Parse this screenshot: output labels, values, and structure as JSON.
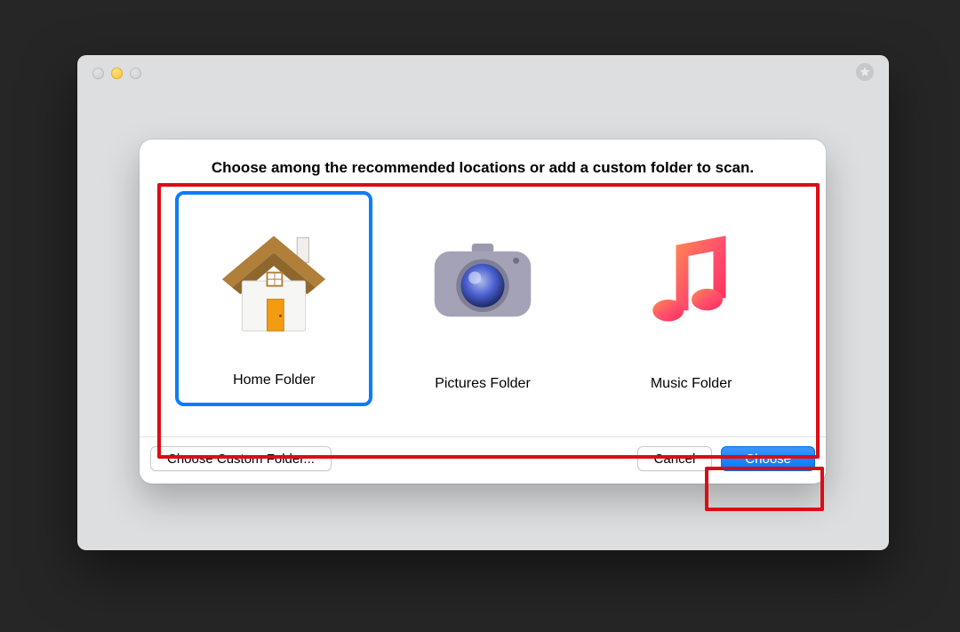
{
  "sheet": {
    "title": "Choose among the recommended locations or add a custom folder to scan."
  },
  "options": {
    "home": {
      "label": "Home Folder",
      "selected": true
    },
    "pictures": {
      "label": "Pictures Folder",
      "selected": false
    },
    "music": {
      "label": "Music Folder",
      "selected": false
    }
  },
  "buttons": {
    "custom": "Choose Custom Folder...",
    "cancel": "Cancel",
    "choose": "Choose"
  }
}
